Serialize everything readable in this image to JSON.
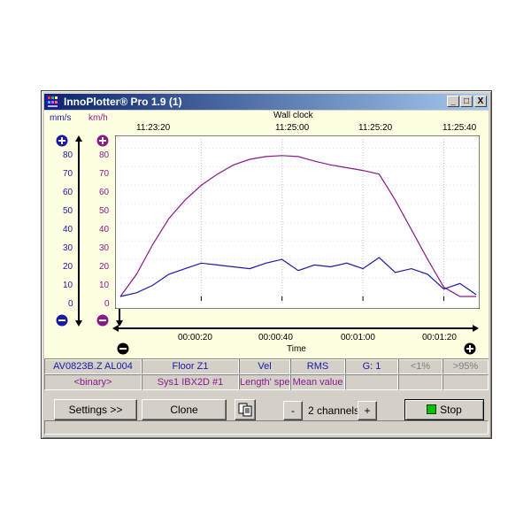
{
  "window": {
    "title": "InnoPlotter® Pro 1.9 (1)",
    "controls": {
      "minimize": "_",
      "maximize": "□",
      "close": "X"
    }
  },
  "axes": {
    "left_unit_1": "mm/s",
    "left_unit_2": "km/h",
    "top_label": "Wall clock",
    "top_ticks": [
      "11:23:20",
      "11:25:00",
      "11:25:20",
      "11:25:40"
    ],
    "bottom_label": "Time",
    "bottom_ticks": [
      "00:00:20",
      "00:00:40",
      "00:01:00",
      "00:01:20"
    ],
    "y_ticks_left": [
      "80",
      "70",
      "60",
      "50",
      "40",
      "30",
      "20",
      "10",
      "0"
    ],
    "y_ticks_right": [
      "80",
      "70",
      "60",
      "50",
      "40",
      "30",
      "20",
      "10",
      "0"
    ]
  },
  "colors": {
    "series1": "#8a1a8a",
    "series2": "#1a1aa6",
    "plot_bg": "#ffffff",
    "panel_bg": "#ffffe1"
  },
  "chart_data": {
    "type": "line",
    "xlabel": "Time",
    "x": [
      0,
      4,
      8,
      12,
      16,
      20,
      24,
      28,
      32,
      36,
      40,
      44,
      48,
      52,
      56,
      60,
      64,
      68,
      72,
      76,
      80,
      84,
      88
    ],
    "series": [
      {
        "values": [
          0,
          12,
          28,
          42,
          52,
          60,
          66,
          71,
          74,
          75.5,
          76,
          75.5,
          73,
          71,
          69.5,
          68,
          66,
          52,
          36,
          20,
          5,
          0,
          0
        ]
      },
      {
        "values": [
          0,
          2,
          6,
          12,
          15,
          18,
          17,
          16,
          15,
          18,
          20,
          14,
          17,
          16,
          18,
          15,
          21,
          13,
          15,
          12,
          4,
          7,
          1
        ]
      }
    ],
    "ylim": [
      0,
      85
    ]
  },
  "status": {
    "row1": [
      "AV0823B.Z AL004",
      "Floor Z1",
      "Vel",
      "RMS",
      "G: 1",
      "<1%",
      ">95%"
    ],
    "row2": [
      "<binary>",
      "Sys1 IBX2D #1",
      "Length' spe",
      "Mean value",
      "",
      "",
      ""
    ]
  },
  "toolbar": {
    "settings": "Settings >>",
    "clone": "Clone",
    "minus": "-",
    "channels": "2 channels",
    "plus": "+",
    "stop": "Stop"
  }
}
